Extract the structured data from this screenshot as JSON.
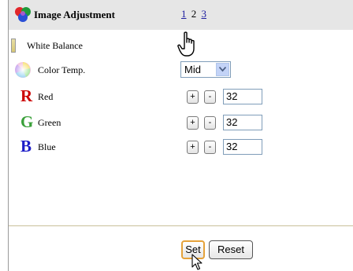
{
  "header": {
    "title": "Image Adjustment",
    "pages": [
      {
        "label": "1",
        "link": true
      },
      {
        "label": "2",
        "link": false
      },
      {
        "label": "3",
        "link": true
      }
    ]
  },
  "rows": {
    "white_balance": {
      "label": "White Balance"
    },
    "color_temp": {
      "label": "Color Temp.",
      "value": "Mid"
    },
    "red": {
      "letter": "R",
      "label": "Red",
      "value": "32",
      "plus": "+",
      "minus": "-"
    },
    "green": {
      "letter": "G",
      "label": "Green",
      "value": "32",
      "plus": "+",
      "minus": "-"
    },
    "blue": {
      "letter": "B",
      "label": "Blue",
      "value": "32",
      "plus": "+",
      "minus": "-"
    }
  },
  "footer": {
    "set_label": "Set",
    "reset_label": "Reset"
  },
  "colors": {
    "red": "#cc0000",
    "green": "#3aa03a",
    "blue": "#1c1cc8",
    "header_bg": "#e6e6e6"
  }
}
